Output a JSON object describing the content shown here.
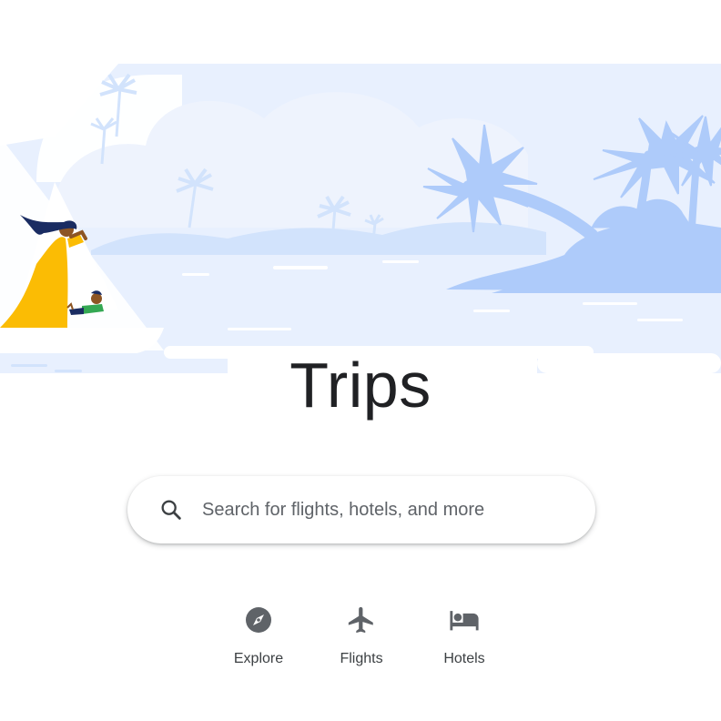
{
  "page": {
    "title": "Trips"
  },
  "search": {
    "placeholder": "Search for flights, hotels, and more",
    "icon": "search-icon"
  },
  "nav": {
    "items": [
      {
        "label": "Explore",
        "icon": "compass-icon"
      },
      {
        "label": "Flights",
        "icon": "airplane-icon"
      },
      {
        "label": "Hotels",
        "icon": "bed-icon"
      }
    ]
  },
  "colors": {
    "hero_light": "#e8f0fe",
    "hero_mid": "#d2e3fc",
    "hero_dark": "#aecbfa",
    "dress": "#fbbc04",
    "title": "#202124",
    "text": "#3c4043",
    "icon": "#5f6368"
  }
}
